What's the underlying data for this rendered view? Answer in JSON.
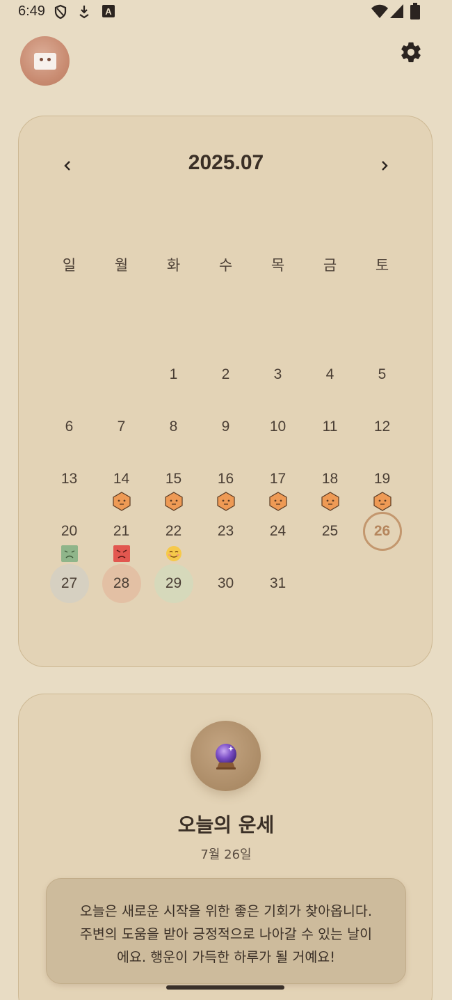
{
  "status_bar": {
    "time": "6:49",
    "left_icons": [
      "shield-icon",
      "download-icon",
      "a-box-icon"
    ],
    "right_icons": [
      "wifi-icon",
      "signal-icon",
      "battery-icon"
    ]
  },
  "header": {
    "avatar": "app-logo-avatar",
    "settings_icon": "gear-icon"
  },
  "calendar": {
    "month_label": "2025.07",
    "prev_icon": "chevron-left-icon",
    "next_icon": "chevron-right-icon",
    "weekdays": [
      "일",
      "월",
      "화",
      "수",
      "목",
      "금",
      "토"
    ],
    "today": 26,
    "days": [
      {
        "d": "1"
      },
      {
        "d": "2"
      },
      {
        "d": "3"
      },
      {
        "d": "4"
      },
      {
        "d": "5"
      },
      {
        "d": "6"
      },
      {
        "d": "7"
      },
      {
        "d": "8"
      },
      {
        "d": "9"
      },
      {
        "d": "10"
      },
      {
        "d": "11"
      },
      {
        "d": "12"
      },
      {
        "d": "13"
      },
      {
        "d": "14",
        "mood": "hexagon-face"
      },
      {
        "d": "15",
        "mood": "hexagon-face"
      },
      {
        "d": "16",
        "mood": "hexagon-face"
      },
      {
        "d": "17",
        "mood": "hexagon-face"
      },
      {
        "d": "18",
        "mood": "hexagon-face"
      },
      {
        "d": "19",
        "mood": "hexagon-face"
      },
      {
        "d": "20",
        "mood": "green-square-face"
      },
      {
        "d": "21",
        "mood": "red-angry-face"
      },
      {
        "d": "22",
        "mood": "smile-emoji"
      },
      {
        "d": "23"
      },
      {
        "d": "24"
      },
      {
        "d": "25"
      },
      {
        "d": "26",
        "today": true
      },
      {
        "d": "27",
        "highlight": "grey"
      },
      {
        "d": "28",
        "highlight": "peach"
      },
      {
        "d": "29",
        "highlight": "green"
      },
      {
        "d": "30"
      },
      {
        "d": "31"
      }
    ],
    "first_weekday_index": 2,
    "colors": {
      "mood_orange": "#ee9a55",
      "mood_green": "#8fb58a",
      "mood_red": "#e2574f",
      "today_ring": "#c3976e",
      "highlight_grey": "#d6d0c1",
      "highlight_peach": "#e3c0a4",
      "highlight_green": "#d6d9bb"
    }
  },
  "fortune": {
    "icon": "crystal-ball-icon",
    "title": "오늘의 운세",
    "date": "7월 26일",
    "lines": [
      "오늘은 새로운 시작을 위한 좋은 기회가 찾아옵니다.",
      "주변의 도움을 받아 긍정적으로 나아갈 수 있는 날이",
      "에요. 행운이 가득한 하루가 될 거예요!"
    ]
  },
  "theme": {
    "background": "#e8dcc4",
    "card": "#e3d3b6",
    "card_border": "#cdb893",
    "text": "#3d3128"
  }
}
